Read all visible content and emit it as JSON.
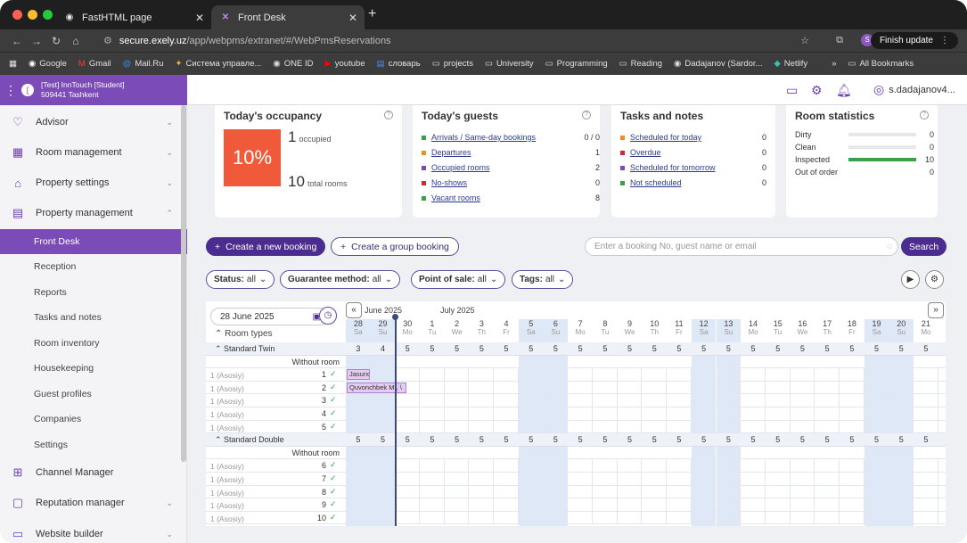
{
  "browser": {
    "tabs": [
      {
        "label": "FastHTML page"
      },
      {
        "label": "Front Desk"
      }
    ],
    "url_host": "secure.exely.uz",
    "url_path": "/app/webpms/extranet/#/WebPmsReservations",
    "finish_update": "Finish update",
    "profile_initial": "S",
    "bookmarks": [
      "Google",
      "Gmail",
      "Mail.Ru",
      "Система управле...",
      "ONE ID",
      "youtube",
      "словарь",
      "projects",
      "University",
      "Programming",
      "Reading",
      "Dadajanov (Sardor...",
      "Netlify",
      "»",
      "All Bookmarks"
    ]
  },
  "app": {
    "property_name": "[Test] InnTouch [Student]",
    "property_sub": "509441 Tashkent",
    "user": "s.dadajanov4..."
  },
  "sidebar": {
    "items": [
      {
        "label": "Advisor"
      },
      {
        "label": "Room management"
      },
      {
        "label": "Property settings"
      },
      {
        "label": "Property management"
      },
      {
        "label": "Channel Manager"
      },
      {
        "label": "Reputation manager"
      },
      {
        "label": "Website builder"
      }
    ],
    "sub_items": [
      {
        "label": "Front Desk"
      },
      {
        "label": "Reception"
      },
      {
        "label": "Reports"
      },
      {
        "label": "Tasks and notes"
      },
      {
        "label": "Room inventory"
      },
      {
        "label": "Housekeeping"
      },
      {
        "label": "Guest profiles"
      },
      {
        "label": "Companies"
      },
      {
        "label": "Settings"
      }
    ]
  },
  "occupancy": {
    "title": "Today's occupancy",
    "percent": "10%",
    "occupied_num": "1",
    "occupied_label": "occupied",
    "total_num": "10",
    "total_label": "total rooms"
  },
  "guests": {
    "title": "Today's guests",
    "rows": [
      {
        "label": "Arrivals / Same-day bookings",
        "value": "0 / 0",
        "color": "#3aa04a"
      },
      {
        "label": "Departures",
        "value": "1",
        "color": "#f08a2a"
      },
      {
        "label": "Occupied rooms",
        "value": "2",
        "color": "#7b4bb7"
      },
      {
        "label": "No-shows",
        "value": "0",
        "color": "#d0283a"
      },
      {
        "label": "Vacant rooms",
        "value": "8",
        "color": "#3aa04a"
      }
    ]
  },
  "tasks": {
    "title": "Tasks and notes",
    "rows": [
      {
        "label": "Scheduled for today",
        "value": "0",
        "color": "#f08a2a"
      },
      {
        "label": "Overdue",
        "value": "0",
        "color": "#d0283a"
      },
      {
        "label": "Scheduled for tomorrow",
        "value": "0",
        "color": "#7b4bb7"
      },
      {
        "label": "Not scheduled",
        "value": "0",
        "color": "#3aa04a"
      }
    ]
  },
  "room_stats": {
    "title": "Room statistics",
    "rows": [
      {
        "label": "Dirty",
        "value": "0",
        "fill": 0
      },
      {
        "label": "Clean",
        "value": "0",
        "fill": 0
      },
      {
        "label": "Inspected",
        "value": "10",
        "fill": 1
      },
      {
        "label": "Out of order",
        "value": "0",
        "fill": 0
      }
    ]
  },
  "actions": {
    "create_booking": "Create a new booking",
    "create_group": "Create a group booking",
    "search_placeholder": "Enter a booking No, guest name or email",
    "search_button": "Search"
  },
  "filters": [
    {
      "key": "Status:",
      "val": "all"
    },
    {
      "key": "Guarantee method:",
      "val": "all"
    },
    {
      "key": "Point of sale:",
      "val": "all"
    },
    {
      "key": "Tags:",
      "val": "all"
    }
  ],
  "calendar": {
    "date": "28 June 2025",
    "month1": "June 2025",
    "month2": "July 2025",
    "room_types_label": "Room types",
    "days": [
      {
        "d": "28",
        "w": "Sa",
        "we": true
      },
      {
        "d": "29",
        "w": "Su",
        "we": true
      },
      {
        "d": "30",
        "w": "Mo",
        "we": false
      },
      {
        "d": "1",
        "w": "Tu",
        "we": false
      },
      {
        "d": "2",
        "w": "We",
        "we": false
      },
      {
        "d": "3",
        "w": "Th",
        "we": false
      },
      {
        "d": "4",
        "w": "Fr",
        "we": false
      },
      {
        "d": "5",
        "w": "Sa",
        "we": true
      },
      {
        "d": "6",
        "w": "Su",
        "we": true
      },
      {
        "d": "7",
        "w": "Mo",
        "we": false
      },
      {
        "d": "8",
        "w": "Tu",
        "we": false
      },
      {
        "d": "9",
        "w": "We",
        "we": false
      },
      {
        "d": "10",
        "w": "Th",
        "we": false
      },
      {
        "d": "11",
        "w": "Fr",
        "we": false
      },
      {
        "d": "12",
        "w": "Sa",
        "we": true
      },
      {
        "d": "13",
        "w": "Su",
        "we": true
      },
      {
        "d": "14",
        "w": "Mo",
        "we": false
      },
      {
        "d": "15",
        "w": "Tu",
        "we": false
      },
      {
        "d": "16",
        "w": "We",
        "we": false
      },
      {
        "d": "17",
        "w": "Th",
        "we": false
      },
      {
        "d": "18",
        "w": "Fr",
        "we": false
      },
      {
        "d": "19",
        "w": "Sa",
        "we": true
      },
      {
        "d": "20",
        "w": "Su",
        "we": true
      },
      {
        "d": "21",
        "w": "Mo",
        "we": false
      }
    ],
    "groups": [
      {
        "name": "Standard Twin",
        "avail": [
          "3",
          "4",
          "5",
          "5",
          "5",
          "5",
          "5",
          "5",
          "5",
          "5",
          "5",
          "5",
          "5",
          "5",
          "5",
          "5",
          "5",
          "5",
          "5",
          "5",
          "5",
          "5",
          "5",
          "5"
        ],
        "without_room": "Without room",
        "rooms": [
          {
            "label": "1 (Asosiy)",
            "num": "1"
          },
          {
            "label": "1 (Asosiy)",
            "num": "2"
          },
          {
            "label": "1 (Asosiy)",
            "num": "3"
          },
          {
            "label": "1 (Asosiy)",
            "num": "4"
          },
          {
            "label": "1 (Asosiy)",
            "num": "5"
          }
        ]
      },
      {
        "name": "Standard Double",
        "avail": [
          "5",
          "5",
          "5",
          "5",
          "5",
          "5",
          "5",
          "5",
          "5",
          "5",
          "5",
          "5",
          "5",
          "5",
          "5",
          "5",
          "5",
          "5",
          "5",
          "5",
          "5",
          "5",
          "5",
          "5"
        ],
        "without_room": "Without room",
        "rooms": [
          {
            "label": "1 (Asosiy)",
            "num": "6"
          },
          {
            "label": "1 (Asosiy)",
            "num": "7"
          },
          {
            "label": "1 (Asosiy)",
            "num": "8"
          },
          {
            "label": "1 (Asosiy)",
            "num": "9"
          },
          {
            "label": "1 (Asosiy)",
            "num": "10"
          }
        ]
      }
    ],
    "bookings": [
      {
        "guest": "Jasurxon E",
        "room": "1",
        "start": 0,
        "days": 1
      },
      {
        "guest": "Quvonchbek M., \\",
        "room": "2",
        "start": 0,
        "days": 2.5
      }
    ]
  }
}
